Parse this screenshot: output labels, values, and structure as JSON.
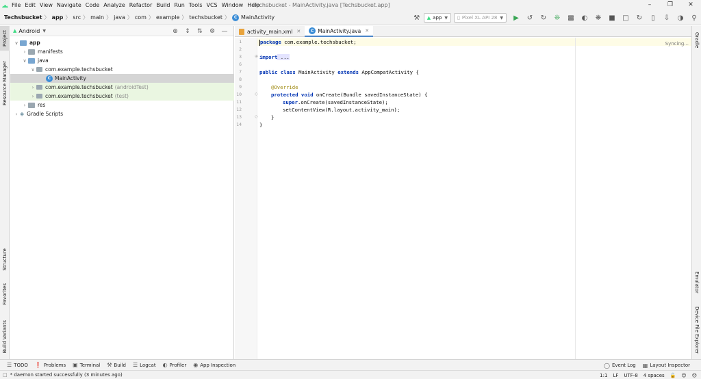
{
  "menubar": {
    "items": [
      "File",
      "Edit",
      "View",
      "Navigate",
      "Code",
      "Analyze",
      "Refactor",
      "Build",
      "Run",
      "Tools",
      "VCS",
      "Window",
      "Help"
    ],
    "window_title": "Techsbucket - MainActivity.java [Techsbucket.app]"
  },
  "breadcrumb": {
    "items": [
      "Techsbucket",
      "app",
      "src",
      "main",
      "java",
      "com",
      "example",
      "techsbucket",
      "MainActivity"
    ]
  },
  "toolbar": {
    "run_config": "app",
    "device": "Pixel XL API 28"
  },
  "left_strip": {
    "project": "Project",
    "resource_manager": "Resource Manager",
    "structure": "Structure",
    "favorites": "Favorites",
    "build_variants": "Build Variants"
  },
  "right_strip": {
    "gradle": "Gradle",
    "emulator": "Emulator",
    "device_file_explorer": "Device File Explorer"
  },
  "project_panel": {
    "view_mode": "Android",
    "tree": {
      "app": "app",
      "manifests": "manifests",
      "java": "java",
      "pkg_main": "com.example.techsbucket",
      "main_activity": "MainActivity",
      "pkg_android_test": "com.example.techsbucket",
      "android_test_tag": "(androidTest)",
      "pkg_test": "com.example.techsbucket",
      "test_tag": "(test)",
      "res": "res",
      "gradle_scripts": "Gradle Scripts"
    }
  },
  "editor": {
    "tabs": [
      "activity_main.xml",
      "MainActivity.java"
    ],
    "line_numbers": [
      "1",
      "2",
      "3",
      "6",
      "7",
      "8",
      "9",
      "10",
      "11",
      "12",
      "13",
      "14"
    ],
    "lines": {
      "l1_kw": "package",
      "l1_rest": " com.example.techsbucket;",
      "l3_kw": "import",
      "l3_rest": " ...",
      "l7_kw1": "public class",
      "l7_mid": " MainActivity ",
      "l7_kw2": "extends",
      "l7_rest": " AppCompatActivity {",
      "l9_ann": "@Override",
      "l10_kw": "protected void",
      "l10_rest": " onCreate(Bundle savedInstanceState) {",
      "l11_kw": "super",
      "l11_rest": ".onCreate(savedInstanceState);",
      "l12": "setContentView(R.layout.activity_main);",
      "l13": "}",
      "l14": "}"
    },
    "status_hint": "Syncing..."
  },
  "bottom_tools": {
    "todo": "TODO",
    "problems": "Problems",
    "terminal": "Terminal",
    "build": "Build",
    "logcat": "Logcat",
    "profiler": "Profiler",
    "app_inspection": "App Inspection",
    "event_log": "Event Log",
    "layout_inspector": "Layout Inspector"
  },
  "statusbar": {
    "message": "* daemon started successfully (3 minutes ago)",
    "position": "1:1",
    "line_sep": "LF",
    "encoding": "UTF-8",
    "indent": "4 spaces"
  }
}
